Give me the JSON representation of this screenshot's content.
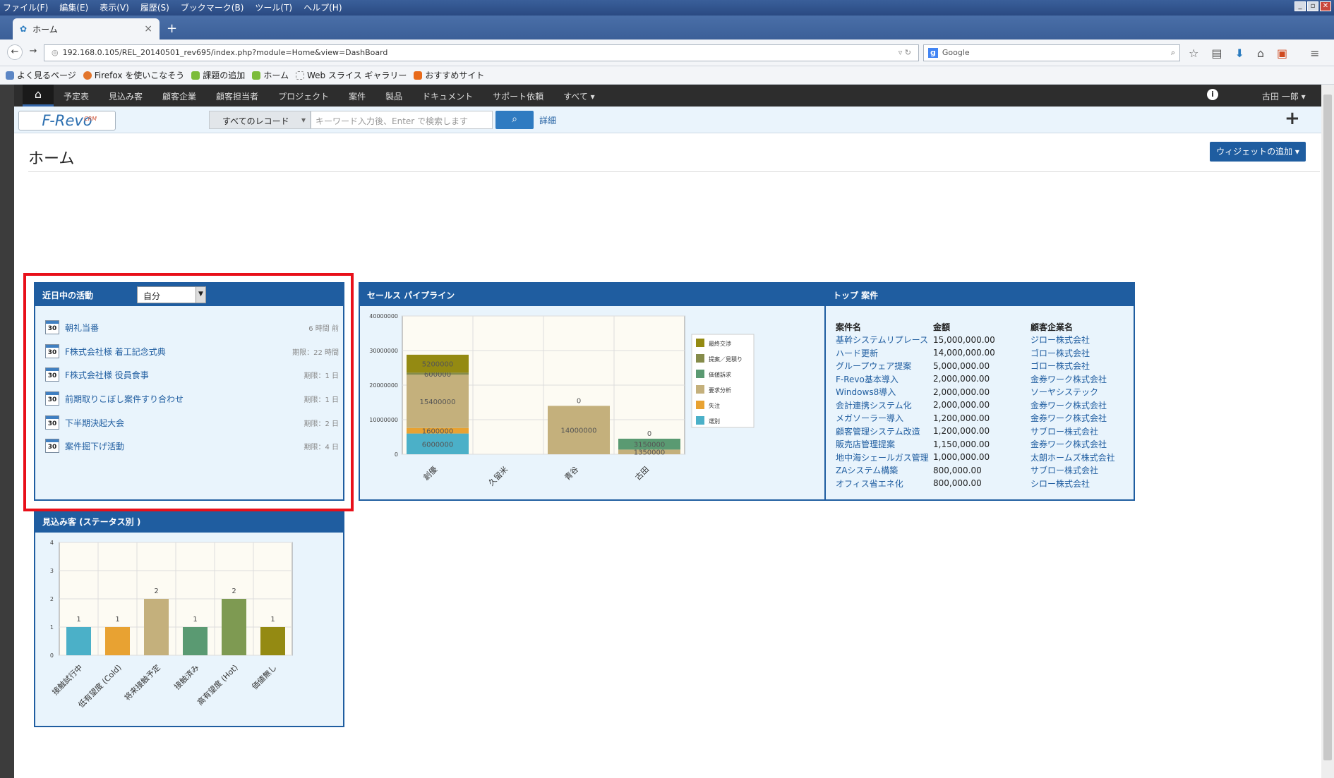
{
  "browser": {
    "menu": [
      "ファイル(F)",
      "編集(E)",
      "表示(V)",
      "履歴(S)",
      "ブックマーク(B)",
      "ツール(T)",
      "ヘルプ(H)"
    ],
    "tab_title": "ホーム",
    "url": "192.168.0.105/REL_20140501_rev695/index.php?module=Home&view=DashBoard",
    "search_placeholder": "Google",
    "bookmarks": [
      "よく見るページ",
      "Firefox を使いこなそう",
      "課題の追加",
      "ホーム",
      "Web スライス ギャラリー",
      "おすすめサイト"
    ]
  },
  "app": {
    "nav": [
      "予定表",
      "見込み客",
      "顧客企業",
      "顧客担当者",
      "プロジェクト",
      "案件",
      "製品",
      "ドキュメント",
      "サポート依頼",
      "すべて ▾"
    ],
    "user": "古田 一郎 ▾",
    "logo": "F-Revo",
    "logo_sup": "CRM",
    "search_scope": "すべてのレコード",
    "search_placeholder": "キーワード入力後、Enter で検索します",
    "detail_link": "詳細",
    "page_title": "ホーム",
    "add_widget": "ウィジェットの追加 ▾"
  },
  "activities": {
    "title": "近日中の活動",
    "filter": "自分",
    "items": [
      {
        "label": "朝礼当番",
        "due": "6 時間 前"
      },
      {
        "label": "F株式会社様 着工記念式典",
        "due": "期限：22 時間"
      },
      {
        "label": "F株式会社様 役員食事",
        "due": "期限：1 日"
      },
      {
        "label": "前期取りこぼし案件すり合わせ",
        "due": "期限：1 日"
      },
      {
        "label": "下半期決起大会",
        "due": "期限：2 日"
      },
      {
        "label": "案件掘下げ活動",
        "due": "期限：4 日"
      }
    ]
  },
  "pipeline": {
    "title": "セールス パイプライン"
  },
  "top_deals": {
    "title": "トップ 案件",
    "headers": [
      "案件名",
      "金額",
      "顧客企業名"
    ],
    "rows": [
      [
        "基幹システムリプレース",
        "15,000,000.00",
        "ジロー株式会社"
      ],
      [
        "ハード更新",
        "14,000,000.00",
        "ゴロー株式会社"
      ],
      [
        "グループウェア提案",
        "5,000,000.00",
        "ゴロー株式会社"
      ],
      [
        "F-Revo基本導入",
        "2,000,000.00",
        "金券ワーク株式会社"
      ],
      [
        "Windows8導入",
        "2,000,000.00",
        "ソーヤシステック"
      ],
      [
        "会計連携システム化",
        "2,000,000.00",
        "金券ワーク株式会社"
      ],
      [
        "メガソーラー導入",
        "1,200,000.00",
        "金券ワーク株式会社"
      ],
      [
        "顧客管理システム改造",
        "1,200,000.00",
        "サブロー株式会社"
      ],
      [
        "販売店管理提案",
        "1,150,000.00",
        "金券ワーク株式会社"
      ],
      [
        "地中海シェールガス管理",
        "1,000,000.00",
        "太朗ホームズ株式会社"
      ],
      [
        "ZAシステム構築",
        "800,000.00",
        "サブロー株式会社"
      ],
      [
        "オフィス省エネ化",
        "800,000.00",
        "シロー株式会社"
      ]
    ]
  },
  "leads": {
    "title": "見込み客 (ステータス別 )"
  },
  "chart_data": [
    {
      "type": "bar",
      "stacked": true,
      "title": "セールス パイプライン",
      "categories": [
        "創優",
        "久留米",
        "青谷",
        "古田"
      ],
      "ylim": [
        0,
        40000000
      ],
      "yticks": [
        0,
        10000000,
        20000000,
        30000000,
        40000000
      ],
      "series": [
        {
          "name": "最終交渉",
          "color": "#948a12",
          "values": [
            5200000,
            0,
            0,
            0
          ]
        },
        {
          "name": "提案／見積り",
          "color": "#858b4a",
          "values": [
            600000,
            0,
            0,
            0
          ]
        },
        {
          "name": "価値訴求",
          "color": "#5a9a72",
          "values": [
            0,
            0,
            0,
            3150000
          ]
        },
        {
          "name": "要求分析",
          "color": "#c4b07c",
          "values": [
            15400000,
            0,
            14000000,
            1350000
          ]
        },
        {
          "name": "失注",
          "color": "#e8a232",
          "values": [
            1600000,
            0,
            0,
            0
          ]
        },
        {
          "name": "選別",
          "color": "#4bb0c8",
          "values": [
            6000000,
            0,
            0,
            0
          ]
        }
      ],
      "extra_labels": [
        {
          "category": "青谷",
          "text": "0"
        },
        {
          "category": "古田",
          "text": "0"
        }
      ]
    },
    {
      "type": "bar",
      "title": "見込み客 (ステータス別 )",
      "categories": [
        "接触試行中",
        "低有望度 (Cold)",
        "将来接触予定",
        "接触済み",
        "高有望度 (Hot)",
        "価値無し"
      ],
      "values": [
        1,
        1,
        2,
        1,
        2,
        1
      ],
      "colors": [
        "#4bb0c8",
        "#e8a232",
        "#c4b07c",
        "#5a9a72",
        "#7e9a52",
        "#948a12"
      ],
      "ylim": [
        0,
        4
      ],
      "yticks": [
        0,
        1,
        2,
        3,
        4
      ]
    }
  ]
}
